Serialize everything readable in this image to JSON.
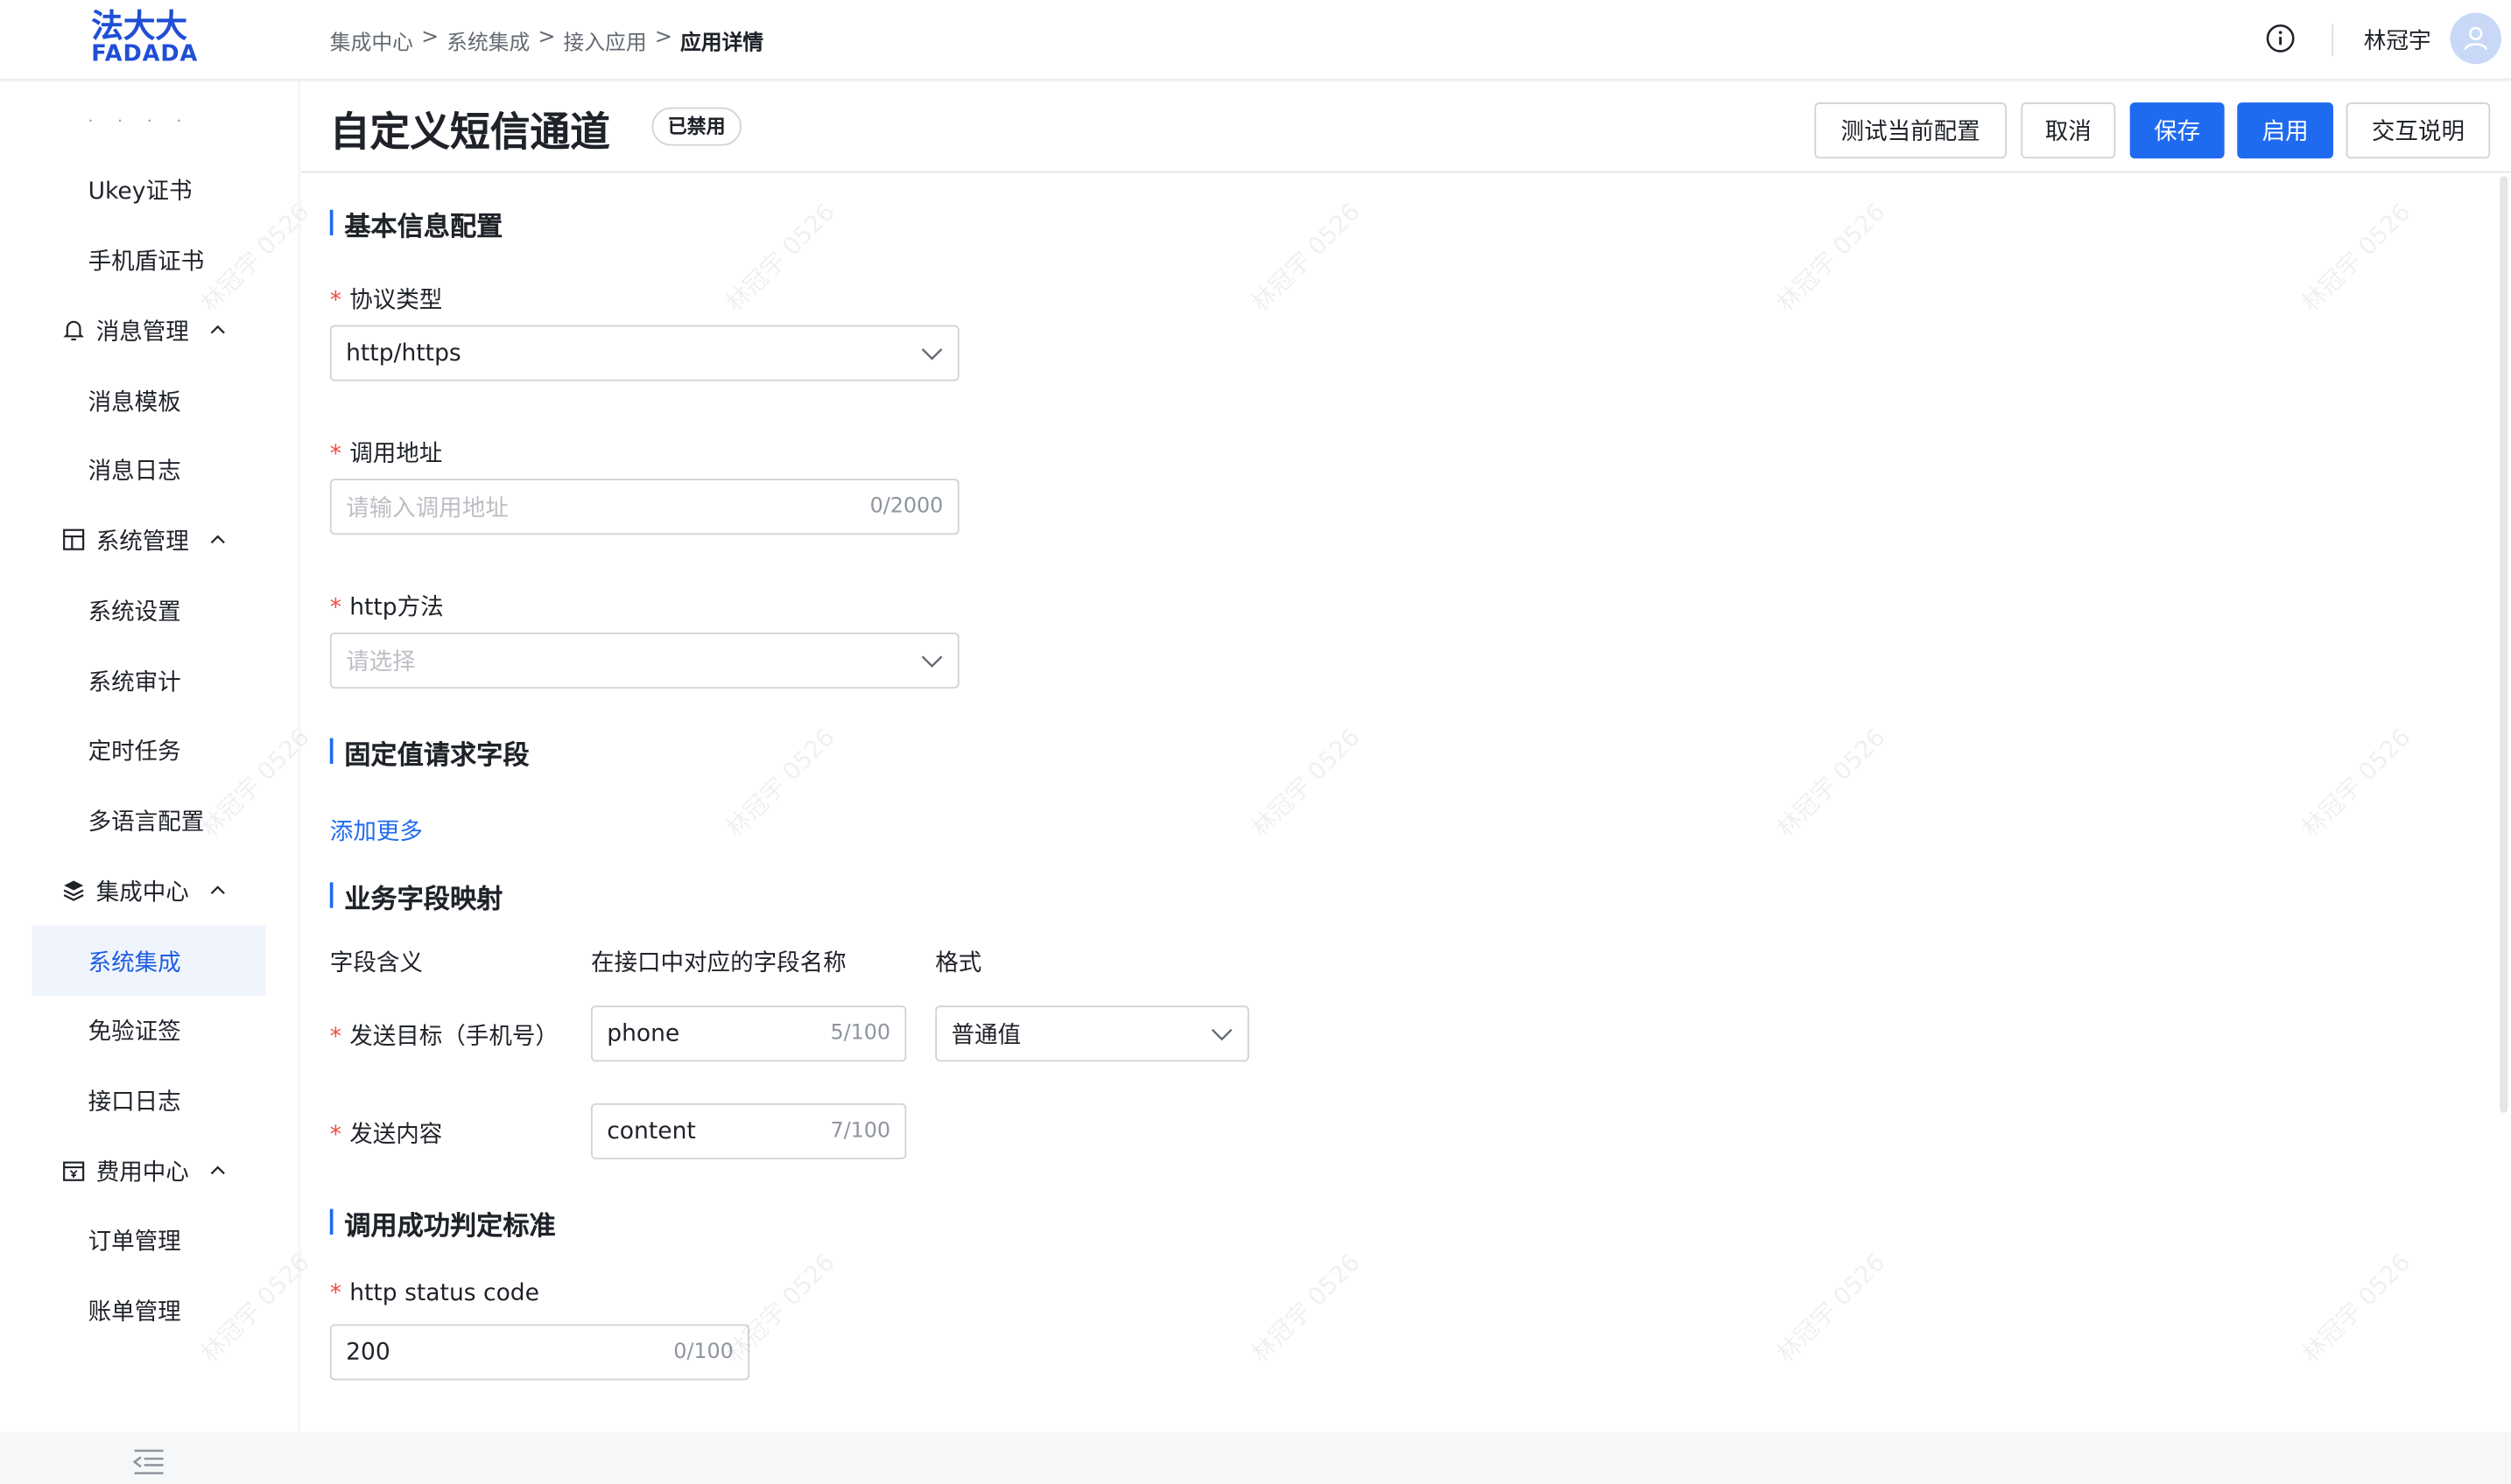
{
  "brand": {
    "logo_cn": "法大大",
    "logo_en": "FADADA"
  },
  "breadcrumb": [
    "集成中心",
    "系统集成",
    "接入应用",
    "应用详情"
  ],
  "breadcrumb_sep": ">",
  "user": {
    "name": "林冠宇"
  },
  "sidebar": {
    "faded_top": "· · · ·",
    "items": [
      {
        "label": "Ukey证书",
        "type": "sub"
      },
      {
        "label": "手机盾证书",
        "type": "sub"
      },
      {
        "label": "消息管理",
        "type": "group",
        "icon": "bell-icon"
      },
      {
        "label": "消息模板",
        "type": "sub"
      },
      {
        "label": "消息日志",
        "type": "sub"
      },
      {
        "label": "系统管理",
        "type": "group",
        "icon": "layout-icon"
      },
      {
        "label": "系统设置",
        "type": "sub"
      },
      {
        "label": "系统审计",
        "type": "sub"
      },
      {
        "label": "定时任务",
        "type": "sub"
      },
      {
        "label": "多语言配置",
        "type": "sub"
      },
      {
        "label": "集成中心",
        "type": "group",
        "icon": "layers-icon"
      },
      {
        "label": "系统集成",
        "type": "sub",
        "active": true
      },
      {
        "label": "免验证签",
        "type": "sub"
      },
      {
        "label": "接口日志",
        "type": "sub"
      },
      {
        "label": "费用中心",
        "type": "group",
        "icon": "wallet-icon"
      },
      {
        "label": "订单管理",
        "type": "sub"
      },
      {
        "label": "账单管理",
        "type": "sub"
      }
    ]
  },
  "header": {
    "title": "自定义短信通道",
    "status": "已禁用",
    "buttons": {
      "test": "测试当前配置",
      "cancel": "取消",
      "save": "保存",
      "enable": "启用",
      "help": "交互说明"
    }
  },
  "basic": {
    "section": "基本信息配置",
    "protocol": {
      "label": "协议类型",
      "value": "http/https"
    },
    "url": {
      "label": "调用地址",
      "placeholder": "请输入调用地址",
      "count": "0/2000"
    },
    "method": {
      "label": "http方法",
      "placeholder": "请选择"
    }
  },
  "fixed": {
    "section": "固定值请求字段",
    "add_more": "添加更多"
  },
  "mapping": {
    "section": "业务字段映射",
    "headers": [
      "字段含义",
      "在接口中对应的字段名称",
      "格式"
    ],
    "rows": [
      {
        "label": "发送目标（手机号）",
        "value": "phone",
        "count": "5/100",
        "format": "普通值"
      },
      {
        "label": "发送内容",
        "value": "content",
        "count": "7/100"
      }
    ]
  },
  "success": {
    "section": "调用成功判定标准",
    "status_code": {
      "label": "http status code",
      "value": "200",
      "count": "0/100"
    }
  },
  "watermark": "林冠宇 0526",
  "colors": {
    "primary": "#1f6bf0",
    "required": "#f54a45",
    "brand": "#1f4fd6"
  }
}
